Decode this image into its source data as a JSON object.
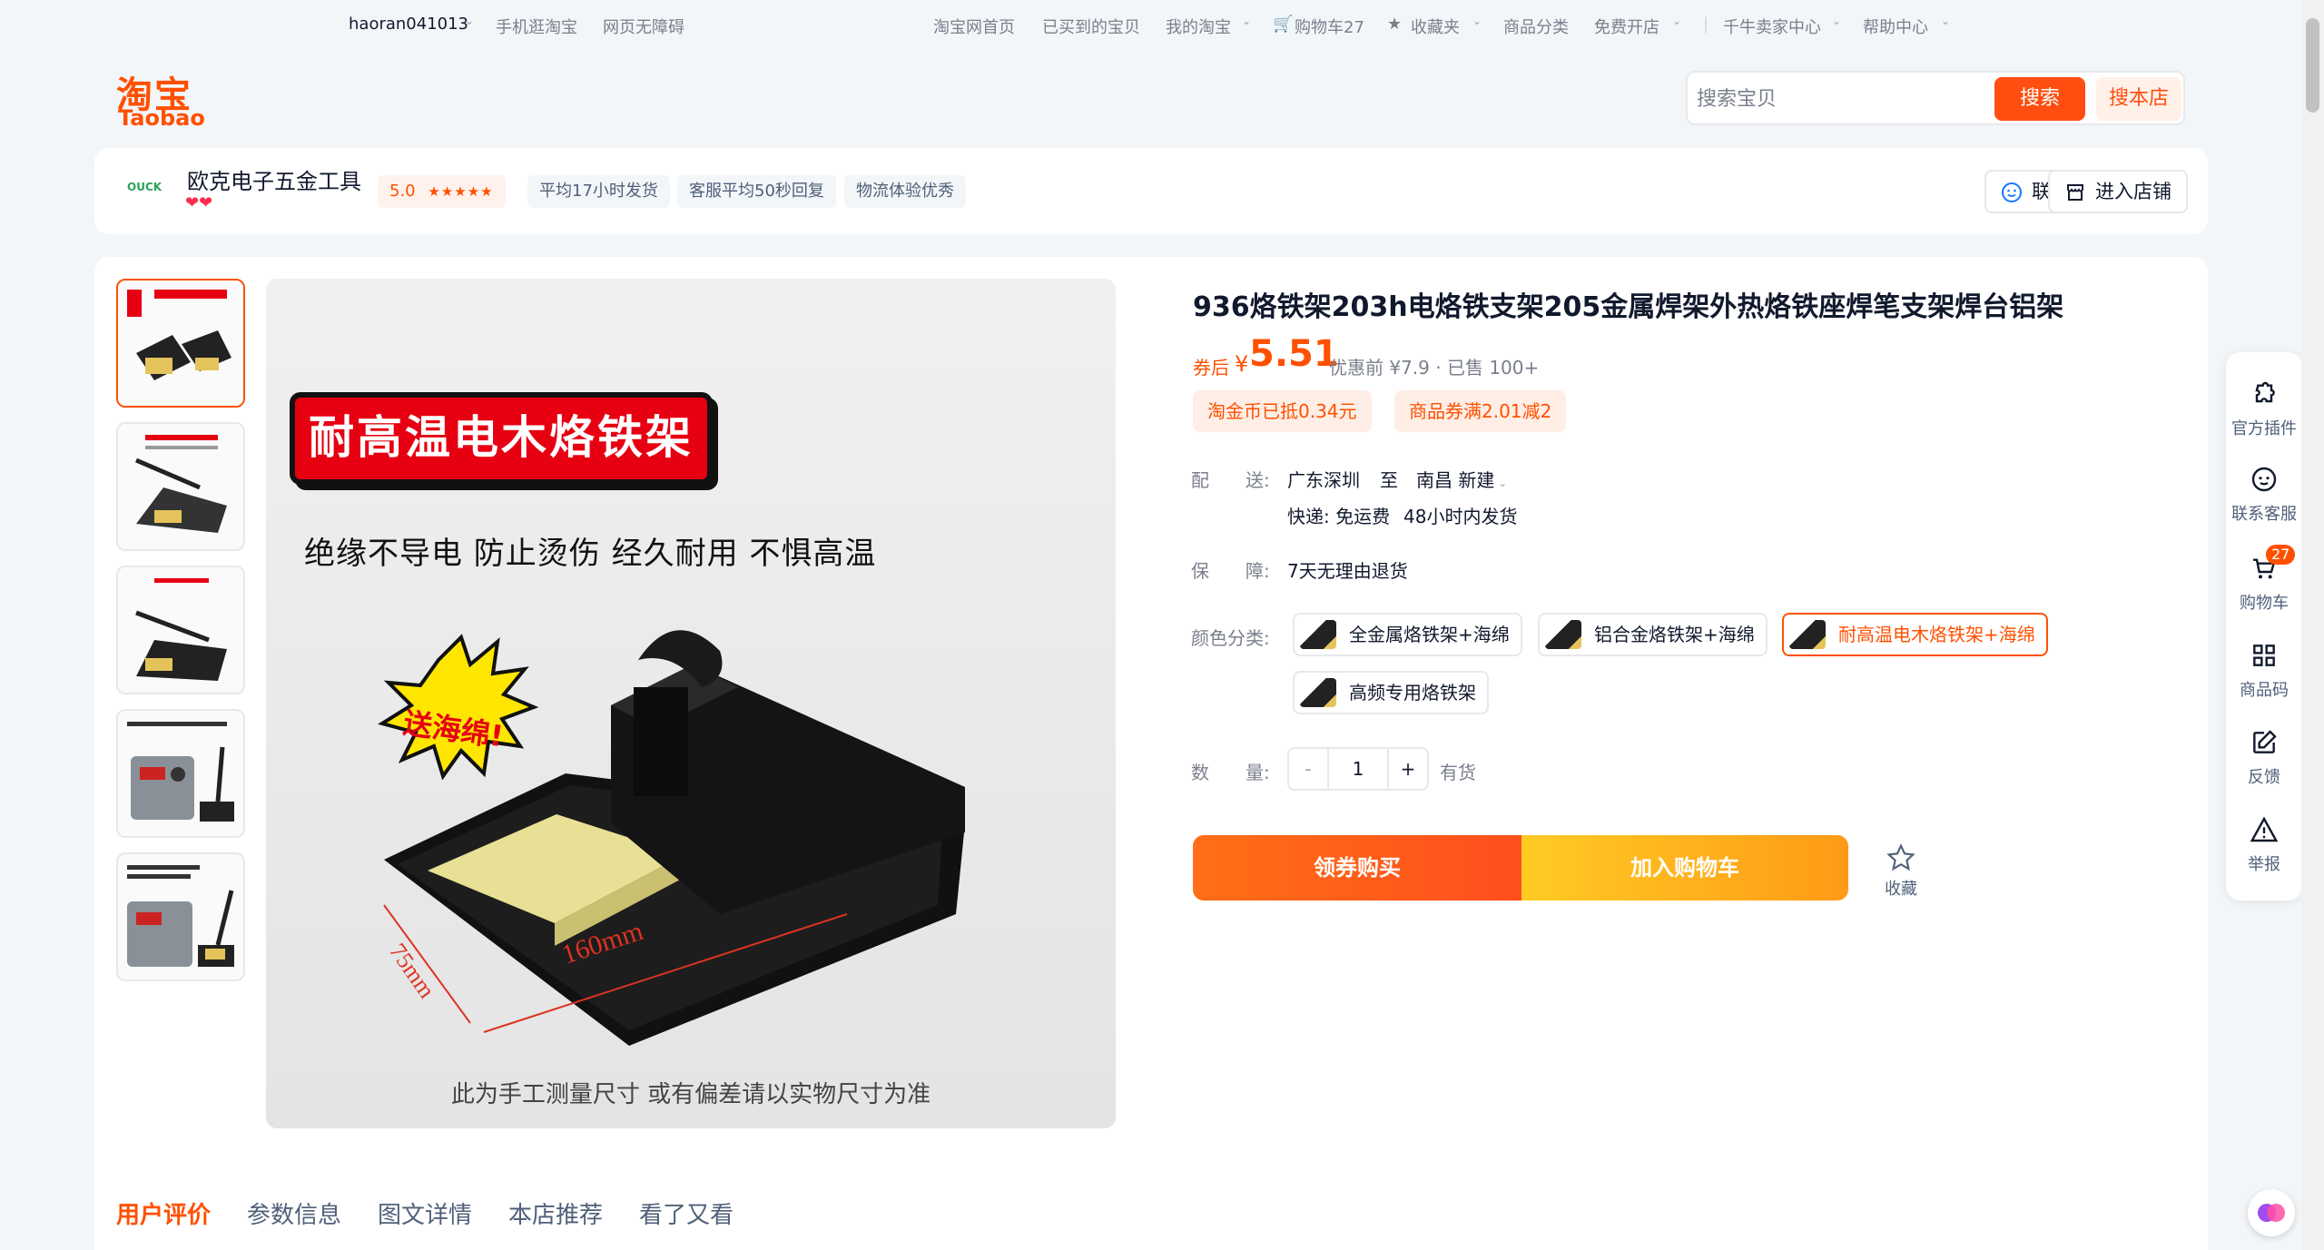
{
  "topbar": {
    "username": "haoran041013",
    "mobile": "手机逛淘宝",
    "accessible": "网页无障碍",
    "home": "淘宝网首页",
    "bought": "已买到的宝贝",
    "my_taobao": "我的淘宝",
    "cart": "购物车27",
    "favorites": "收藏夹",
    "categories": "商品分类",
    "open_shop": "免费开店",
    "seller_center": "千牛卖家中心",
    "help": "帮助中心"
  },
  "header": {
    "logo_cn": "淘宝",
    "logo_en": "Taobao",
    "search_placeholder": "搜索宝贝",
    "search_button": "搜索",
    "search_shop_button": "搜本店"
  },
  "shop": {
    "logo_text": "OUCK",
    "name": "欧克电子五金工具",
    "hearts": "❤❤",
    "score": "5.0",
    "stars": "★★★★★",
    "tags": [
      "平均17小时发货",
      "客服平均50秒回复",
      "物流体验优秀"
    ],
    "contact_button": "联系客服",
    "enter_button": "进入店铺"
  },
  "gallery": {
    "banner_text": "耐高温电木烙铁架",
    "sub_text": "绝缘不导电 防止烫伤 经久耐用 不惧高温",
    "burst_text": "送海绵!",
    "dim_long": "160mm",
    "dim_short": "75mm",
    "footer_text": "此为手工测量尺寸 或有偏差请以实物尺寸为准"
  },
  "product": {
    "title": "936烙铁架203h电烙铁支架205金属焊架外热烙铁座焊笔支架焊台铝架",
    "price_label": "券后",
    "currency": "¥",
    "price": "5.51",
    "original": "优惠前 ¥7.9 · 已售 100+",
    "coupons": [
      "淘金币已抵0.34元",
      "商品券满2.01减2"
    ],
    "delivery_label": "配　　送:",
    "delivery_from": "广东深圳",
    "delivery_to_word": "至",
    "delivery_to": "南昌 新建",
    "express": "快递: 免运费",
    "ship_time": "48小时内发货",
    "guarantee_label": "保　　障:",
    "guarantee": "7天无理由退货",
    "color_label": "颜色分类:",
    "skus": [
      "全金属烙铁架+海绵",
      "铝合金烙铁架+海绵",
      "耐高温电木烙铁架+海绵",
      "高频专用烙铁架"
    ],
    "qty_label": "数　　量:",
    "qty_minus": "-",
    "qty_value": "1",
    "qty_plus": "+",
    "stock": "有货",
    "buy_button": "领券购买",
    "cart_button": "加入购物车",
    "fav_label": "收藏"
  },
  "tabs": [
    "用户评价",
    "参数信息",
    "图文详情",
    "本店推荐",
    "看了又看"
  ],
  "sidebar": {
    "items": [
      {
        "label": "官方插件"
      },
      {
        "label": "联系客服"
      },
      {
        "label": "购物车",
        "badge": "27"
      },
      {
        "label": "商品码"
      },
      {
        "label": "反馈"
      },
      {
        "label": "举报"
      }
    ]
  },
  "colors": {
    "brand": "#ff5000",
    "cart_gradient": "#ffcb24",
    "selected_border": "#ff5000"
  }
}
